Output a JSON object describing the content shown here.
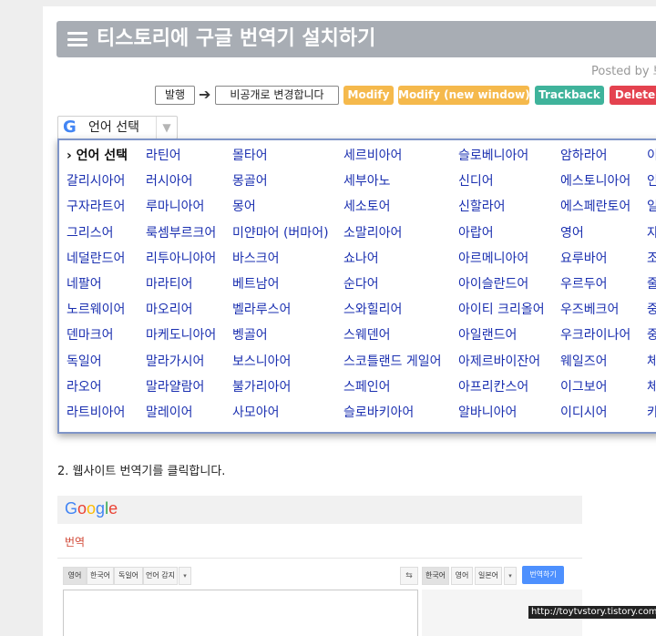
{
  "post": {
    "title": "티스토리에 구글 번역기 설치하기",
    "posted_by": "Posted by 브"
  },
  "toolbar": {
    "publish": "발행",
    "make_private": "비공개로 변경합니다",
    "modify": "Modify",
    "modify_new_window": "Modify (new window)",
    "trackback": "Trackback",
    "delete": "Delete"
  },
  "translate_widget": {
    "select_label": "언어 선택",
    "dropdown_glyph": "▼",
    "columns": [
      [
        "› 언어 선택",
        "갈리시아어",
        "구자라트어",
        "그리스어",
        "네덜란드어",
        "네팔어",
        "노르웨이어",
        "덴마크어",
        "독일어",
        "라오어",
        "라트비아어"
      ],
      [
        "라틴어",
        "러시아어",
        "루마니아어",
        "룩셈부르크어",
        "리투아니아어",
        "마라티어",
        "마오리어",
        "마케도니아어",
        "말라가시어",
        "말라얄람어",
        "말레이어"
      ],
      [
        "몰타어",
        "몽골어",
        "몽어",
        "미얀마어 (버마어)",
        "바스크어",
        "베트남어",
        "벨라루스어",
        "벵골어",
        "보스니아어",
        "불가리아어",
        "사모아어"
      ],
      [
        "세르비아어",
        "세부아노",
        "세소토어",
        "소말리아어",
        "쇼나어",
        "순다어",
        "스와힐리어",
        "스웨덴어",
        "스코틀랜드 게일어",
        "스페인어",
        "슬로바키아어"
      ],
      [
        "슬로베니아어",
        "신디어",
        "신할라어",
        "아랍어",
        "아르메니아어",
        "아이슬란드어",
        "아이티 크리올어",
        "아일랜드어",
        "아제르바이잔어",
        "아프리칸스어",
        "알바니아어"
      ],
      [
        "암하라어",
        "에스토니아어",
        "에스페란토어",
        "영어",
        "요루바어",
        "우르두어",
        "우즈베크어",
        "우크라이나어",
        "웨일즈어",
        "이그보어",
        "이디시어"
      ],
      [
        "이",
        "인",
        "일",
        "자",
        "조",
        "줄",
        "중",
        "중",
        "체",
        "체",
        "카"
      ]
    ]
  },
  "body": {
    "step2": "2. 웹사이트 번역기를 클릭합니다."
  },
  "gt_screenshot": {
    "logo": [
      "G",
      "o",
      "o",
      "g",
      "l",
      "e"
    ],
    "logo_colors": [
      "#4285f4",
      "#ea4335",
      "#fbbc05",
      "#4285f4",
      "#34a853",
      "#ea4335"
    ],
    "subtitle": "번역",
    "src_tabs": [
      "영어",
      "한국어",
      "독일어",
      "언어 감지"
    ],
    "dst_tabs": [
      "한국어",
      "영어",
      "일본어"
    ],
    "translate_button": "번역하기",
    "swap_glyph": "⇆",
    "dd_glyph": "▾"
  },
  "watermark": "http://toytvstory.tistory.com",
  "colors": {
    "title_bar": "#a8adb4",
    "orange_button": "#f5b94c",
    "teal_button": "#3fb39b",
    "red_button": "#e4424f",
    "link": "#1a2fb0",
    "menu_border": "#7f95c8"
  }
}
